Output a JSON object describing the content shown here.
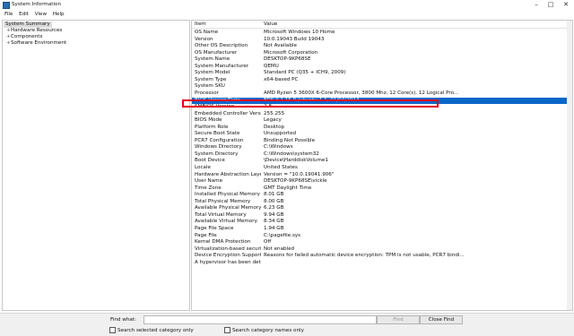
{
  "window": {
    "title": "System Information"
  },
  "menu": [
    "File",
    "Edit",
    "View",
    "Help"
  ],
  "tree": {
    "root": "System Summary",
    "children": [
      "Hardware Resources",
      "Components",
      "Software Environment"
    ]
  },
  "table": {
    "headers": {
      "item": "Item",
      "value": "Value"
    },
    "selected_index": 10,
    "rows": [
      {
        "item": "OS Name",
        "value": "Microsoft Windows 10 Home"
      },
      {
        "item": "Version",
        "value": "10.0.19043 Build 19043"
      },
      {
        "item": "Other OS Description",
        "value": "Not Available"
      },
      {
        "item": "OS Manufacturer",
        "value": "Microsoft Corporation"
      },
      {
        "item": "System Name",
        "value": "DESKTOP-9KP68SE"
      },
      {
        "item": "System Manufacturer",
        "value": "QEMU"
      },
      {
        "item": "System Model",
        "value": "Standard PC (Q35 + ICH9, 2009)"
      },
      {
        "item": "System Type",
        "value": "x64-based PC"
      },
      {
        "item": "System SKU",
        "value": ""
      },
      {
        "item": "Processor",
        "value": "AMD Ryzen 5 3600X 6-Core Processor, 3800 Mhz, 12 Core(s), 12 Logical Pro..."
      },
      {
        "item": "BIOS Version/Date",
        "value": "EDK II 1.15.0 /ubuntu-1.1, 01/04/2014"
      },
      {
        "item": "SMBIOS Version",
        "value": "2.8"
      },
      {
        "item": "Embedded Controller Version",
        "value": "255.255"
      },
      {
        "item": "BIOS Mode",
        "value": "Legacy"
      },
      {
        "item": "Platform Role",
        "value": "Desktop"
      },
      {
        "item": "Secure Boot State",
        "value": "Unsupported"
      },
      {
        "item": "PCR7 Configuration",
        "value": "Binding Not Possible"
      },
      {
        "item": "Windows Directory",
        "value": "C:\\Windows"
      },
      {
        "item": "System Directory",
        "value": "C:\\Windows\\system32"
      },
      {
        "item": "Boot Device",
        "value": "\\Device\\HarddiskVolume1"
      },
      {
        "item": "Locale",
        "value": "United States"
      },
      {
        "item": "Hardware Abstraction Layer",
        "value": "Version = \"10.0.19041.906\""
      },
      {
        "item": "User Name",
        "value": "DESKTOP-9KP68SE\\vickle"
      },
      {
        "item": "Time Zone",
        "value": "GMT Daylight Time"
      },
      {
        "item": "Installed Physical Memory (RAM)",
        "value": "8.01 GB"
      },
      {
        "item": "Total Physical Memory",
        "value": "8.00 GB"
      },
      {
        "item": "Available Physical Memory",
        "value": "6.23 GB"
      },
      {
        "item": "Total Virtual Memory",
        "value": "9.94 GB"
      },
      {
        "item": "Available Virtual Memory",
        "value": "8.34 GB"
      },
      {
        "item": "Page File Space",
        "value": "1.94 GB"
      },
      {
        "item": "Page File",
        "value": "C:\\pagefile.sys"
      },
      {
        "item": "Kernel DMA Protection",
        "value": "Off"
      },
      {
        "item": "Virtualization-based security",
        "value": "Not enabled"
      },
      {
        "item": "Device Encryption Support",
        "value": "Reasons for failed automatic device encryption: TPM is not usable, PCR7 bindi..."
      },
      {
        "item": "A hypervisor has been detecte...",
        "value": ""
      }
    ]
  },
  "find": {
    "label": "Find what:",
    "value": "",
    "find_button": "Find",
    "close_button": "Close Find",
    "search_selected_label": "Search selected category only",
    "search_names_label": "Search category names only"
  },
  "colors": {
    "selection": "#0a67c9",
    "highlight_box": "#e0001a"
  }
}
